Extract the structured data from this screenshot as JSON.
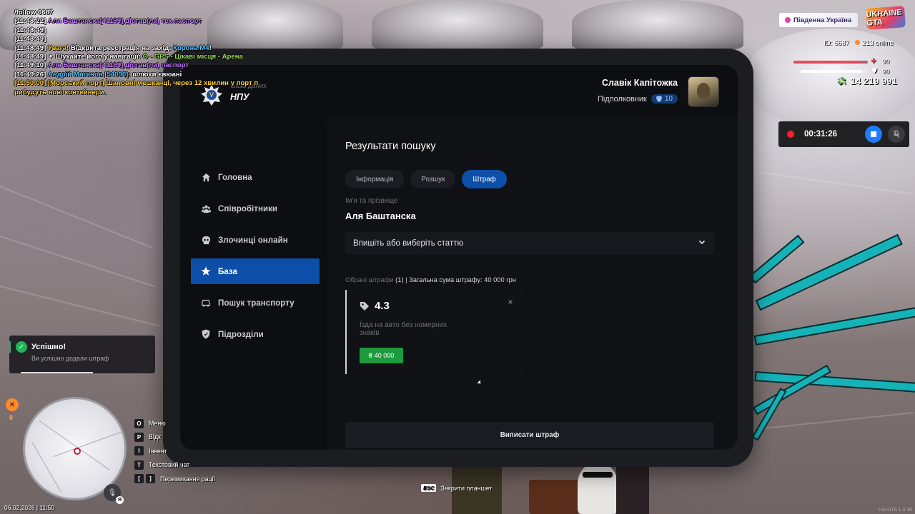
{
  "chat": [
    {
      "parts": [
        {
          "c": "t",
          "text": "/follow 6687"
        }
      ]
    },
    {
      "parts": [
        {
          "c": "t",
          "text": "[11:48:22] "
        },
        {
          "c": "p",
          "text": "Аля Баштанска[41199] дістав(ла) тех.паспорт"
        }
      ]
    },
    {
      "parts": [
        {
          "c": "t",
          "text": "[11:48:49]"
        }
      ]
    },
    {
      "parts": [
        {
          "c": "t",
          "text": "[11:48:49]"
        }
      ]
    },
    {
      "parts": [
        {
          "c": "t",
          "text": "[11:48:49] "
        },
        {
          "c": "y",
          "text": "Увага! "
        },
        {
          "c": "t",
          "text": "Відкрита реєстрація на захід: "
        },
        {
          "c": "b",
          "text": "Корона М4"
        },
        {
          "c": "t",
          "text": "!"
        }
      ]
    },
    {
      "parts": [
        {
          "c": "t",
          "text": "[11:48:49]  ✦  Шукайте його у навігації: "
        },
        {
          "c": "g",
          "text": "O - GPS - Цікаві місця - Арена"
        }
      ]
    },
    {
      "parts": [
        {
          "c": "t",
          "text": "[11:49:10] "
        },
        {
          "c": "p",
          "text": "Аля Баштанска[41199] дістав(ла) паспорт"
        }
      ]
    },
    {
      "parts": [
        {
          "c": "t",
          "text": "[11:49:26] "
        },
        {
          "c": "b",
          "text": "Андрій Миганов [54090]: "
        },
        {
          "c": "t",
          "text": "шлюхи євюані"
        }
      ]
    },
    {
      "parts": [
        {
          "c": "y",
          "text": "[11:50:00] [Морський порт] Шановні мешканці, через 12 хвилин у порт п"
        }
      ]
    },
    {
      "parts": [
        {
          "c": "y",
          "text": "рибудуть нові контейнери."
        }
      ]
    }
  ],
  "hud": {
    "server": "Південна Україна",
    "logo": "UKRAINE GTA",
    "id": "ID: 6687",
    "online": "213 online",
    "health": "90",
    "health_pct": 90,
    "armor": "90",
    "armor_pct": 90,
    "money": "14 219 991",
    "rec_time": "00:31:26"
  },
  "tablet": {
    "logo_sub": "База даних",
    "logo_name": "НПУ",
    "user_name": "Славік Капітожка",
    "user_rank": "Підполковник",
    "rank_level": "10",
    "nav": [
      {
        "label": "Головна",
        "icon": "home-icon",
        "active": false
      },
      {
        "label": "Співробітники",
        "icon": "users-icon",
        "active": false
      },
      {
        "label": "Злочинці онлайн",
        "icon": "skull-icon",
        "active": false
      },
      {
        "label": "База",
        "icon": "star-icon",
        "active": true
      },
      {
        "label": "Пошук транспорту",
        "icon": "car-icon",
        "active": false
      },
      {
        "label": "Підрозділи",
        "icon": "shield-icon",
        "active": false
      }
    ],
    "main": {
      "title": "Результати пошуку",
      "tabs": [
        {
          "label": "Інформація",
          "active": false
        },
        {
          "label": "Розшук",
          "active": false
        },
        {
          "label": "Штраф",
          "active": true
        }
      ],
      "field_label": "Ім'я та прізвище",
      "field_value": "Аля Баштанска",
      "select_placeholder": "Впишіть або виберіть статтю",
      "summary_label": "Обрані штрафи",
      "summary_value": " (1) | Загальна сума штрафу: 40 000 грн",
      "fine": {
        "code": "4.3",
        "description": "Їзда на авто без номерних знаків",
        "price": "40 000",
        "currency": "₴"
      },
      "issue_button": "Виписати штраф"
    }
  },
  "toast": {
    "title": "Успішно!",
    "message": "Ви успішно додали штраф"
  },
  "map": {
    "wrench_count": "0",
    "datetime": "06.02.2026 | 11:50",
    "lang": "Я"
  },
  "keys": [
    {
      "key": "O",
      "label": "Меню"
    },
    {
      "key": "P",
      "label": "Відк"
    },
    {
      "key": "I",
      "label": "Інвент"
    },
    {
      "key": "T",
      "label": "Текстовий чат"
    },
    {
      "key": "[ ]",
      "label": "Перемикання рації"
    }
  ],
  "esc_hint": {
    "key": "ESC",
    "label": "Закрити планшет"
  },
  "watermark": "UA-GTA 1.0  38",
  "colors": {
    "accent": "#0d4fa8",
    "success": "#1e9b3e",
    "tablet_bg": "#0d0e11",
    "teal": "#15b3b8"
  }
}
